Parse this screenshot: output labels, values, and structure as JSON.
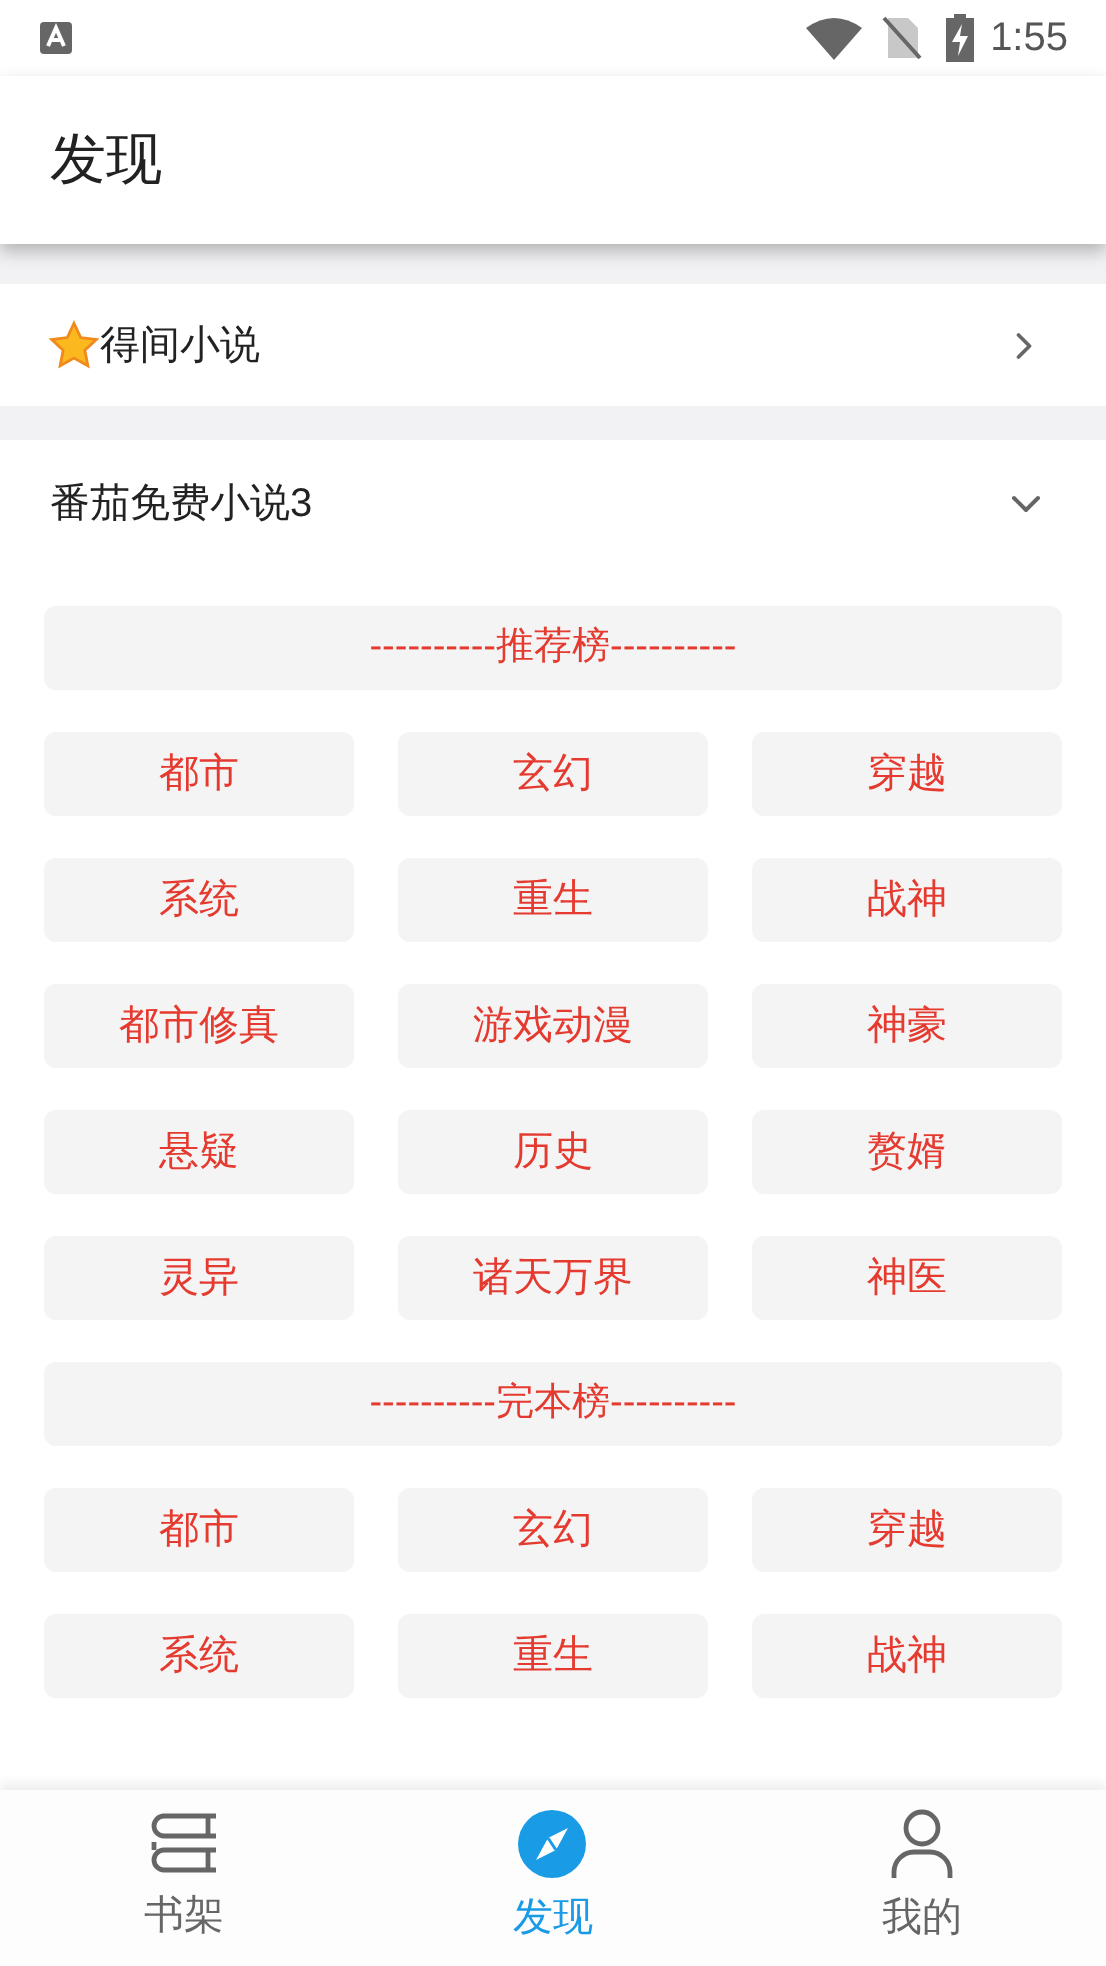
{
  "status_bar": {
    "time": "1:55"
  },
  "header": {
    "title": "发现"
  },
  "favorite": {
    "label": "得间小说"
  },
  "source": {
    "label": "番茄免费小说3",
    "expanded": true,
    "groups": [
      {
        "title": "----------推荐榜----------",
        "tags": [
          "都市",
          "玄幻",
          "穿越",
          "系统",
          "重生",
          "战神",
          "都市修真",
          "游戏动漫",
          "神豪",
          "悬疑",
          "历史",
          "赘婿",
          "灵异",
          "诸天万界",
          "神医"
        ]
      },
      {
        "title": "----------完本榜----------",
        "tags": [
          "都市",
          "玄幻",
          "穿越",
          "系统",
          "重生",
          "战神"
        ]
      }
    ]
  },
  "bottom_nav": [
    {
      "label": "书架",
      "kind": "books",
      "selected": false
    },
    {
      "label": "发现",
      "kind": "compass",
      "selected": true
    },
    {
      "label": "我的",
      "kind": "person",
      "selected": false
    }
  ]
}
